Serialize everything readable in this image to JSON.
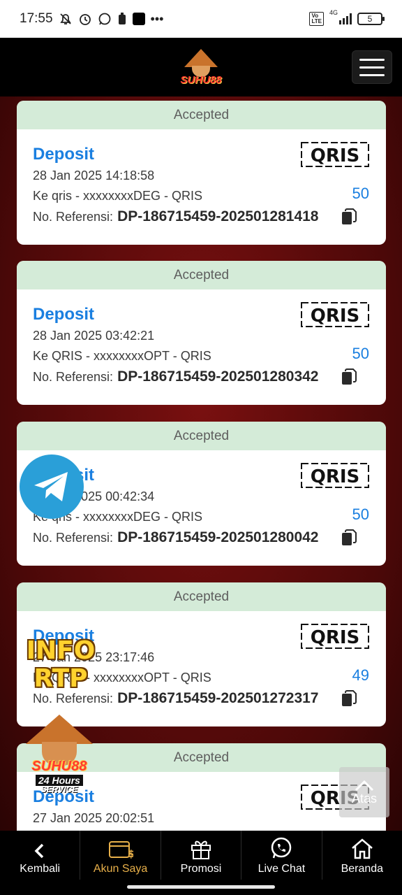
{
  "status_bar": {
    "time": "17:55",
    "battery": "5",
    "network": "4G"
  },
  "header": {
    "brand": "SUHU88"
  },
  "transactions": [
    {
      "status": "Accepted",
      "type": "Deposit",
      "date": "28 Jan 2025 14:18:58",
      "destination": "Ke qris - xxxxxxxxDEG - QRIS",
      "amount": "50",
      "ref_label": "No. Referensi:",
      "ref": "DP-186715459-202501281418"
    },
    {
      "status": "Accepted",
      "type": "Deposit",
      "date": "28 Jan 2025 03:42:21",
      "destination": "Ke QRIS - xxxxxxxxOPT - QRIS",
      "amount": "50",
      "ref_label": "No. Referensi:",
      "ref": "DP-186715459-202501280342"
    },
    {
      "status": "Accepted",
      "type": "Deposit",
      "date": "28 Jan 2025 00:42:34",
      "destination": "Ke qris - xxxxxxxxDEG - QRIS",
      "amount": "50",
      "ref_label": "No. Referensi:",
      "ref": "DP-186715459-202501280042"
    },
    {
      "status": "Accepted",
      "type": "Deposit",
      "date": "27 Jan 2025 23:17:46",
      "destination": "Ke QRIS - xxxxxxxxOPT - QRIS",
      "amount": "49",
      "ref_label": "No. Referensi:",
      "ref": "DP-186715459-202501272317"
    },
    {
      "status": "Accepted",
      "type": "Deposit",
      "date": "27 Jan 2025 20:02:51",
      "destination": "",
      "amount": "",
      "ref_label": "",
      "ref": ""
    }
  ],
  "qris_label": "QRIS",
  "floating": {
    "info_rtp_line1": "INFO",
    "info_rtp_line2": "RTP",
    "service_name": "SUHU88",
    "service_tag": "24 Hours",
    "service_tag2": "SERVICE",
    "back_to_top": "Atas"
  },
  "bottom_nav": [
    {
      "label": "Kembali",
      "icon": "chevron-left-icon"
    },
    {
      "label": "Akun Saya",
      "icon": "wallet-icon",
      "active": true
    },
    {
      "label": "Promosi",
      "icon": "gift-icon"
    },
    {
      "label": "Live Chat",
      "icon": "whatsapp-icon"
    },
    {
      "label": "Beranda",
      "icon": "home-icon"
    }
  ],
  "colors": {
    "accent": "#1a7fe0",
    "status_bg": "#d4ebd8",
    "active_nav": "#e8b04a"
  }
}
